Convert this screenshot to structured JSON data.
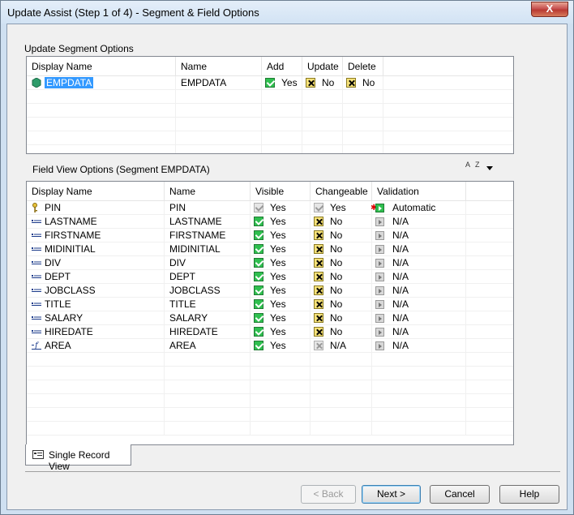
{
  "window": {
    "title": "Update Assist  (Step 1 of 4) - Segment & Field Options",
    "close_glyph": "X"
  },
  "segment": {
    "label": "Update Segment Options",
    "columns": [
      "Display Name",
      "Name",
      "Add",
      "Update",
      "Delete"
    ],
    "row": {
      "display_name": "EMPDATA",
      "name": "EMPDATA",
      "add": "Yes",
      "update": "No",
      "delete": "No",
      "icon": "segment-icon"
    }
  },
  "fields": {
    "label": "Field View Options (Segment EMPDATA)",
    "sort_glyph": "A Z",
    "columns": [
      "Display Name",
      "Name",
      "Visible",
      "Changeable",
      "Validation"
    ],
    "rows": [
      {
        "display_name": "PIN",
        "name": "PIN",
        "visible": "Yes",
        "changeable": "Yes",
        "validation": "Automatic",
        "icon": "key-icon",
        "visible_state": "disabled-yes",
        "changeable_state": "disabled-yes",
        "validation_state": "active"
      },
      {
        "display_name": "LASTNAME",
        "name": "LASTNAME",
        "visible": "Yes",
        "changeable": "No",
        "validation": "N/A",
        "icon": "field-icon",
        "visible_state": "yes",
        "changeable_state": "no",
        "validation_state": "na"
      },
      {
        "display_name": "FIRSTNAME",
        "name": "FIRSTNAME",
        "visible": "Yes",
        "changeable": "No",
        "validation": "N/A",
        "icon": "field-icon",
        "visible_state": "yes",
        "changeable_state": "no",
        "validation_state": "na"
      },
      {
        "display_name": "MIDINITIAL",
        "name": "MIDINITIAL",
        "visible": "Yes",
        "changeable": "No",
        "validation": "N/A",
        "icon": "field-icon",
        "visible_state": "yes",
        "changeable_state": "no",
        "validation_state": "na"
      },
      {
        "display_name": "DIV",
        "name": "DIV",
        "visible": "Yes",
        "changeable": "No",
        "validation": "N/A",
        "icon": "field-icon",
        "visible_state": "yes",
        "changeable_state": "no",
        "validation_state": "na"
      },
      {
        "display_name": "DEPT",
        "name": "DEPT",
        "visible": "Yes",
        "changeable": "No",
        "validation": "N/A",
        "icon": "field-icon",
        "visible_state": "yes",
        "changeable_state": "no",
        "validation_state": "na"
      },
      {
        "display_name": "JOBCLASS",
        "name": "JOBCLASS",
        "visible": "Yes",
        "changeable": "No",
        "validation": "N/A",
        "icon": "field-icon",
        "visible_state": "yes",
        "changeable_state": "no",
        "validation_state": "na"
      },
      {
        "display_name": "TITLE",
        "name": "TITLE",
        "visible": "Yes",
        "changeable": "No",
        "validation": "N/A",
        "icon": "field-icon",
        "visible_state": "yes",
        "changeable_state": "no",
        "validation_state": "na"
      },
      {
        "display_name": "SALARY",
        "name": "SALARY",
        "visible": "Yes",
        "changeable": "No",
        "validation": "N/A",
        "icon": "field-icon",
        "visible_state": "yes",
        "changeable_state": "no",
        "validation_state": "na"
      },
      {
        "display_name": "HIREDATE",
        "name": "HIREDATE",
        "visible": "Yes",
        "changeable": "No",
        "validation": "N/A",
        "icon": "field-icon",
        "visible_state": "yes",
        "changeable_state": "no",
        "validation_state": "na"
      },
      {
        "display_name": "AREA",
        "name": "AREA",
        "visible": "Yes",
        "changeable": "N/A",
        "validation": "N/A",
        "icon": "computed-field-icon",
        "visible_state": "yes",
        "changeable_state": "na",
        "validation_state": "na"
      }
    ]
  },
  "tab": {
    "label": "Single Record View"
  },
  "buttons": {
    "back": "< Back",
    "next": "Next >",
    "cancel": "Cancel",
    "help": "Help"
  }
}
